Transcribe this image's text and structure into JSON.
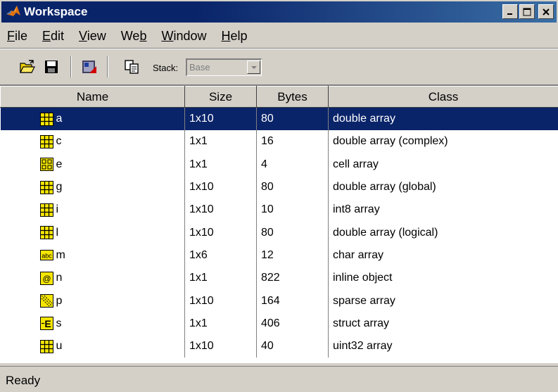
{
  "window": {
    "title": "Workspace",
    "controls": {
      "minimize": "_",
      "maximize": "□",
      "close": "x"
    }
  },
  "menu": {
    "items": [
      {
        "label": "File",
        "mnemonic": "F"
      },
      {
        "label": "Edit",
        "mnemonic": "E"
      },
      {
        "label": "View",
        "mnemonic": "V"
      },
      {
        "label": "Web",
        "mnemonic": "b"
      },
      {
        "label": "Window",
        "mnemonic": "W"
      },
      {
        "label": "Help",
        "mnemonic": "H"
      }
    ]
  },
  "toolbar": {
    "buttons": [
      {
        "icon": "open-folder-icon"
      },
      {
        "icon": "save-icon"
      },
      {
        "icon": "import-data-icon"
      },
      {
        "icon": "copy-icon"
      }
    ],
    "stack_label": "Stack:",
    "stack_value": "Base"
  },
  "table": {
    "columns": [
      "Name",
      "Size",
      "Bytes",
      "Class"
    ],
    "rows": [
      {
        "icon": "matrix-icon",
        "name": "a",
        "size": "1x10",
        "bytes": "80",
        "class": "double array",
        "selected": true
      },
      {
        "icon": "matrix-icon",
        "name": "c",
        "size": "1x1",
        "bytes": "16",
        "class": "double array (complex)"
      },
      {
        "icon": "cell-icon",
        "name": "e",
        "size": "1x1",
        "bytes": "4",
        "class": "cell array"
      },
      {
        "icon": "matrix-icon",
        "name": "g",
        "size": "1x10",
        "bytes": "80",
        "class": "double array (global)"
      },
      {
        "icon": "matrix-icon",
        "name": "i",
        "size": "1x10",
        "bytes": "10",
        "class": "int8 array"
      },
      {
        "icon": "matrix-icon",
        "name": "l",
        "size": "1x10",
        "bytes": "80",
        "class": "double array (logical)"
      },
      {
        "icon": "char-icon",
        "icon_text": "abc",
        "name": "m",
        "size": "1x6",
        "bytes": "12",
        "class": "char array"
      },
      {
        "icon": "object-icon",
        "icon_text": "@",
        "name": "n",
        "size": "1x1",
        "bytes": "822",
        "class": "inline object"
      },
      {
        "icon": "sparse-icon",
        "name": "p",
        "size": "1x10",
        "bytes": "164",
        "class": "sparse array"
      },
      {
        "icon": "struct-icon",
        "icon_text": "E",
        "name": "s",
        "size": "1x1",
        "bytes": "406",
        "class": "struct array"
      },
      {
        "icon": "matrix-icon",
        "name": "u",
        "size": "1x10",
        "bytes": "40",
        "class": "uint32 array"
      }
    ]
  },
  "status": {
    "text": "Ready"
  },
  "colors": {
    "title_bar": "#0a246a",
    "selection": "#0a246a",
    "chrome": "#d4d0c8",
    "icon_yellow": "#f5e600"
  }
}
